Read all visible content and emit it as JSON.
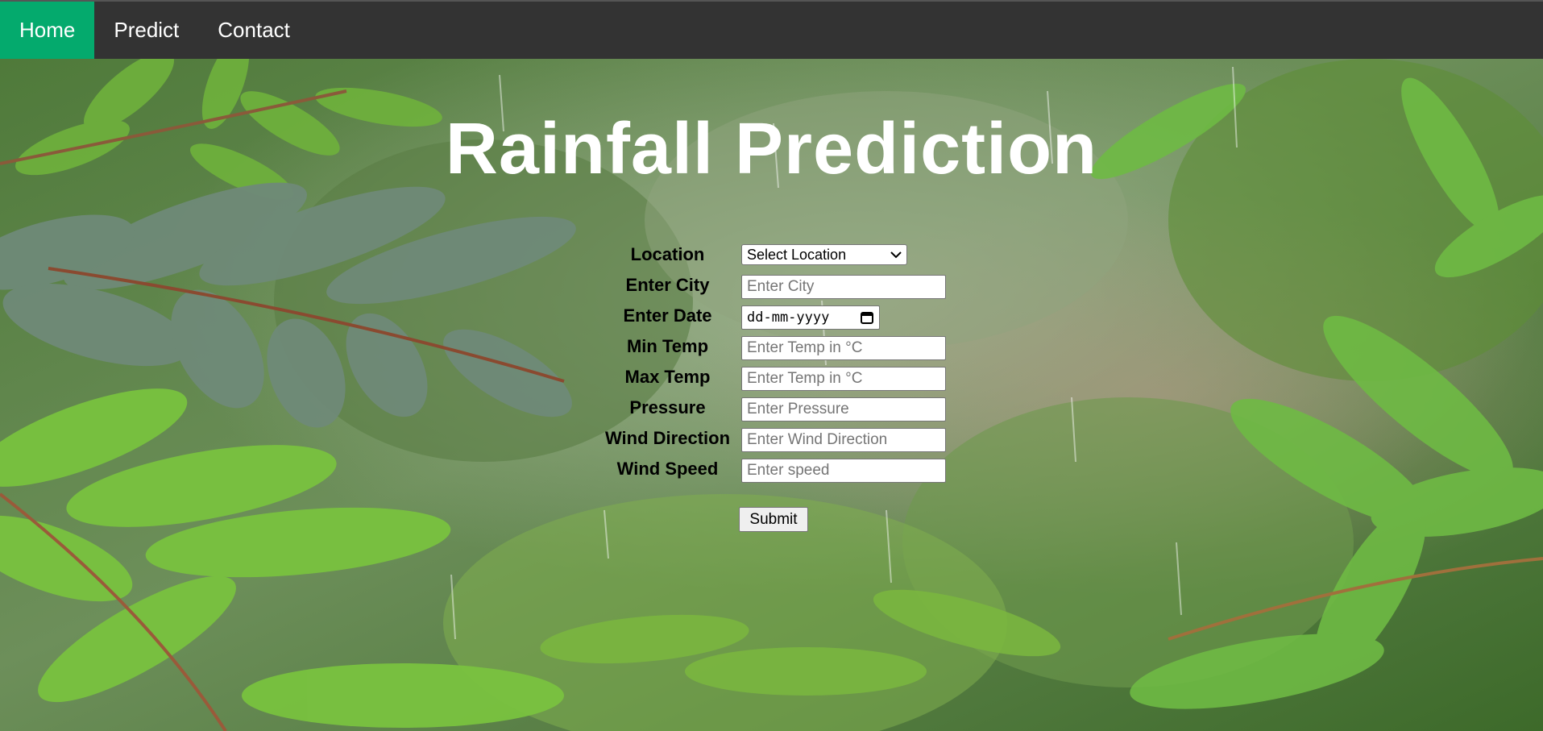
{
  "nav": {
    "items": [
      {
        "label": "Home",
        "active": true
      },
      {
        "label": "Predict",
        "active": false
      },
      {
        "label": "Contact",
        "active": false
      }
    ],
    "active_color": "#04aa6d",
    "bar_color": "#333333"
  },
  "page": {
    "title": "Rainfall Prediction",
    "background": "rain-forest-leaves-photo"
  },
  "form": {
    "location": {
      "label": "Location",
      "selected": "Select Location"
    },
    "city": {
      "label": "Enter City",
      "placeholder": "Enter City"
    },
    "date": {
      "label": "Enter Date",
      "placeholder": "dd-mm-yyyy"
    },
    "min_temp": {
      "label": "Min Temp",
      "placeholder": "Enter Temp in °C"
    },
    "max_temp": {
      "label": "Max Temp",
      "placeholder": "Enter Temp in °C"
    },
    "pressure": {
      "label": "Pressure",
      "placeholder": "Enter Pressure"
    },
    "wind_direction": {
      "label": "Wind Direction",
      "placeholder": "Enter Wind Direction"
    },
    "wind_speed": {
      "label": "Wind Speed",
      "placeholder": "Enter speed"
    },
    "submit_label": "Submit"
  }
}
